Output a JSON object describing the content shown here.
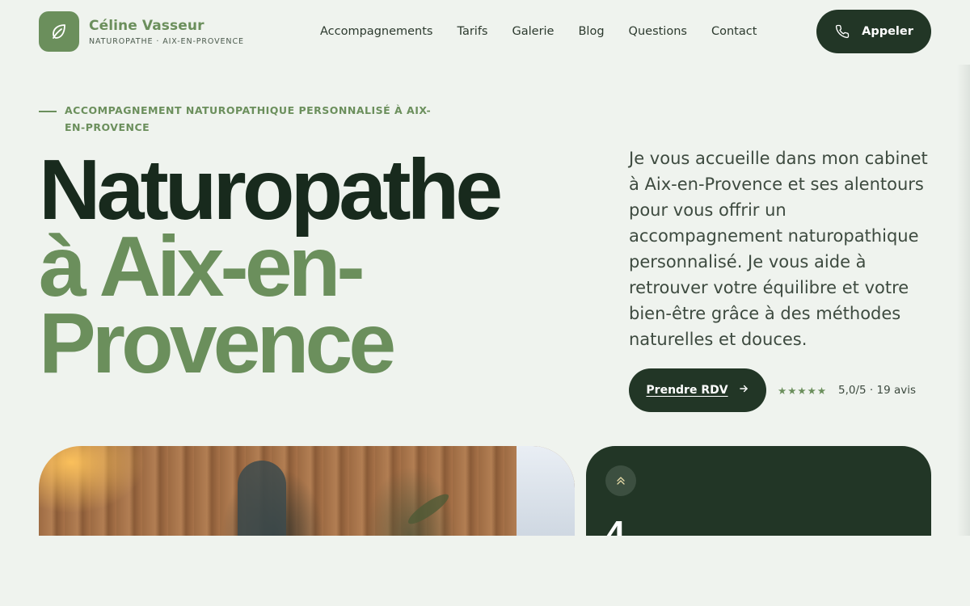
{
  "brand": {
    "name": "Céline Vasseur",
    "subtitle": "NATUROPATHE · AIX-EN-PROVENCE",
    "logo_icon": "leaf-icon",
    "color": "#6b8f5c"
  },
  "nav": {
    "items": [
      {
        "label": "Accompagnements"
      },
      {
        "label": "Tarifs"
      },
      {
        "label": "Galerie"
      },
      {
        "label": "Blog"
      },
      {
        "label": "Questions"
      },
      {
        "label": "Contact"
      }
    ]
  },
  "header": {
    "call_label": "Appeler",
    "call_icon": "phone-icon"
  },
  "hero": {
    "eyebrow": "ACCOMPAGNEMENT NATUROPATHIQUE PERSONNALISÉ À AIX-EN-PROVENCE",
    "title_line1": "Naturopathe",
    "title_line2": "à Aix-en-Provence",
    "description": "Je vous accueille dans mon cabinet à Aix-en-Provence et ses alentours pour vous offrir un accompagnement naturopathique personnalisé. Je vous aide à retrouver votre équilibre et votre bien-être grâce à des méthodes naturelles et douces.",
    "cta_label": "Prendre RDV",
    "cta_icon": "arrow-right-icon",
    "stars": "★★★★★",
    "rating": "5,0/5 · 19 avis"
  },
  "cards": {
    "dark_icon": "double-chevron-up-icon",
    "dark_number": "4"
  },
  "colors": {
    "background": "#eff3ee",
    "accent": "#6b8f5c",
    "dark": "#223626",
    "title": "#182a1d"
  }
}
